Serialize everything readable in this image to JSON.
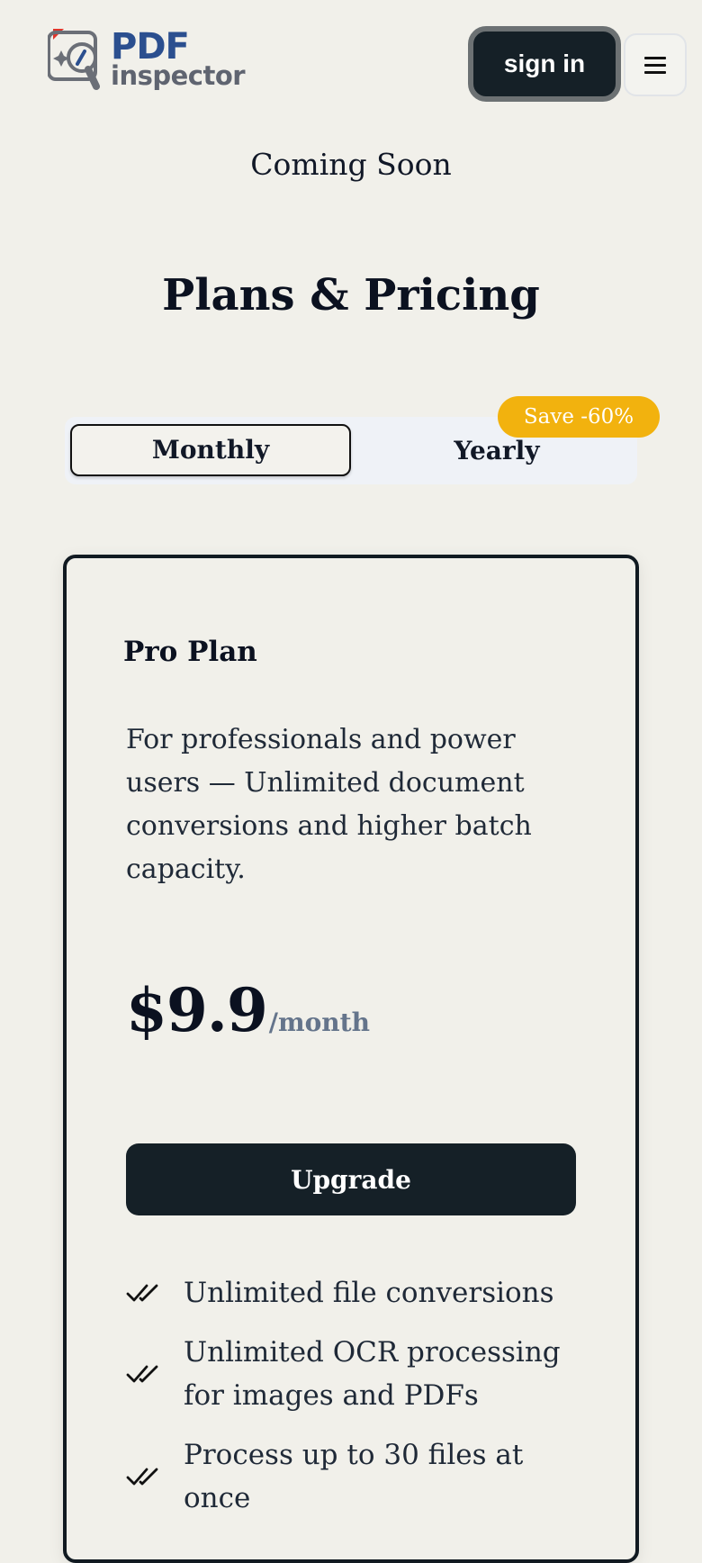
{
  "header": {
    "logo": {
      "brand_line1": "PDF",
      "brand_line2": "inspector"
    },
    "signin_label": "sign in",
    "menu_icon": "hamburger-menu-icon"
  },
  "banner": {
    "coming_soon": "Coming Soon"
  },
  "pricing": {
    "title": "Plans & Pricing",
    "billing_toggle": {
      "options": [
        "Monthly",
        "Yearly"
      ],
      "selected": "Monthly",
      "badge": "Save -60%"
    },
    "plan": {
      "name": "Pro Plan",
      "description": "For professionals and power users — Unlimited document conversions and higher batch capacity.",
      "price": "$9.9",
      "period": "/month",
      "cta_label": "Upgrade",
      "features": [
        "Unlimited file conversions",
        "Unlimited OCR processing for images and PDFs",
        "Process up to 30 files at once"
      ]
    }
  },
  "colors": {
    "background": "#f1f0ea",
    "primary_dark": "#152027",
    "brand_blue": "#2b4f8f",
    "badge_yellow": "#f2b20e",
    "muted_text": "#64748b"
  }
}
